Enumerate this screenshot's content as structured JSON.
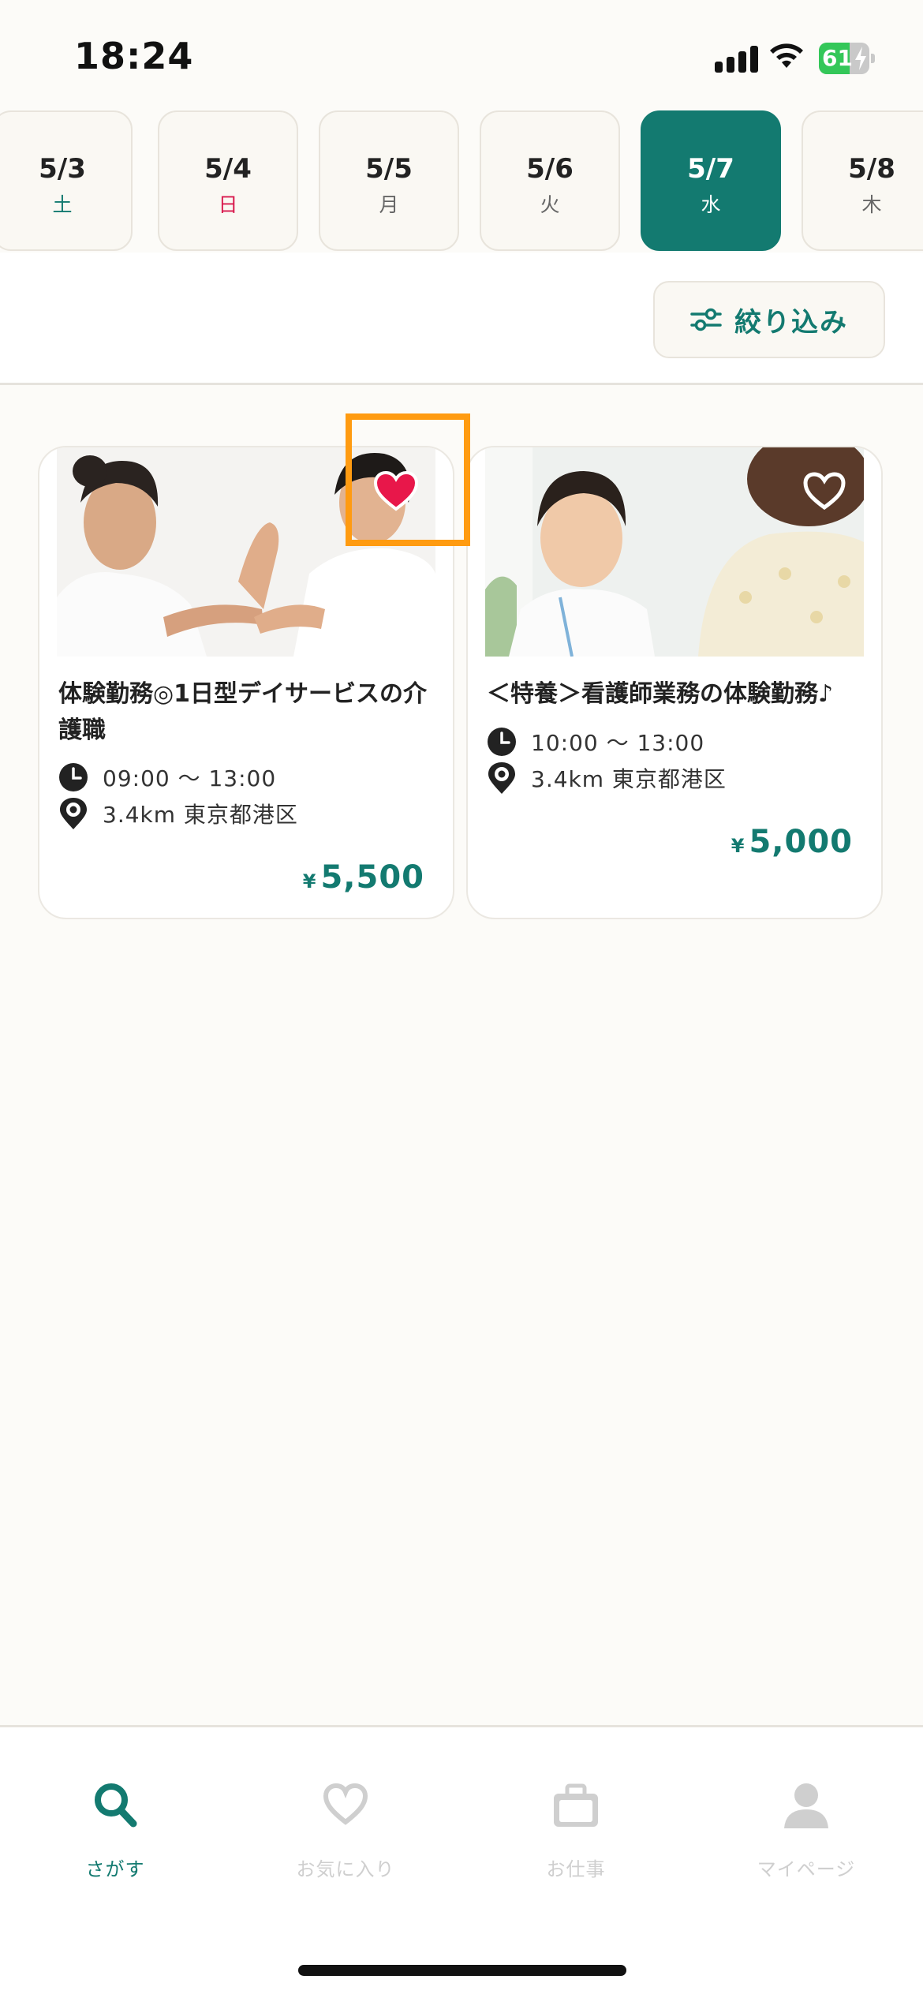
{
  "status_bar": {
    "time": "18:24",
    "battery": "61",
    "battery_level": 0.61,
    "icons": [
      "signal-icon",
      "wifi-icon",
      "battery-charging-icon"
    ]
  },
  "dates": [
    {
      "date": "5/3",
      "weekday": "土",
      "kind": "sat"
    },
    {
      "date": "5/4",
      "weekday": "日",
      "kind": "sun"
    },
    {
      "date": "5/5",
      "weekday": "月",
      "kind": "weekday"
    },
    {
      "date": "5/6",
      "weekday": "火",
      "kind": "weekday"
    },
    {
      "date": "5/7",
      "weekday": "水",
      "kind": "selected"
    },
    {
      "date": "5/8",
      "weekday": "木",
      "kind": "weekday"
    }
  ],
  "filter": {
    "label": "絞り込み",
    "icon": "sliders-icon"
  },
  "jobs": [
    {
      "title": "体験勤務◎1日型デイサービスの介護職",
      "time": "09:00 〜 13:00",
      "location": "3.4km 東京都港区",
      "currency": "¥",
      "price": "5,500",
      "favorited": true
    },
    {
      "title": "＜特養＞看護師業務の体験勤務♪",
      "time": "10:00 〜 13:00",
      "location": "3.4km 東京都港区",
      "currency": "¥",
      "price": "5,000",
      "favorited": false
    }
  ],
  "nav": [
    {
      "label": "さがす",
      "icon": "search-icon",
      "active": true
    },
    {
      "label": "お気に入り",
      "icon": "heart-icon",
      "active": false
    },
    {
      "label": "お仕事",
      "icon": "briefcase-icon",
      "active": false
    },
    {
      "label": "マイページ",
      "icon": "person-icon",
      "active": false
    }
  ],
  "colors": {
    "accent": "#137a70",
    "sunday": "#d8194d",
    "favorite": "#e8174a",
    "highlight": "#ff9b11",
    "background": "#fcfbf8"
  }
}
